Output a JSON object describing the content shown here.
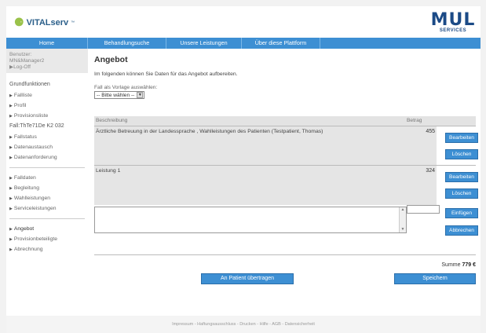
{
  "logo": {
    "name": "VITALserv",
    "trademark": "™"
  },
  "partner_logo": {
    "big": "MUL",
    "small": "SERVICES"
  },
  "nav": [
    {
      "label": "Home"
    },
    {
      "label": "Behandlungsuche"
    },
    {
      "label": "Unsere Leistungen"
    },
    {
      "label": "Über diese Plattform"
    },
    {
      "label": ""
    }
  ],
  "sidebar": {
    "user_label": "Benutzer:",
    "user_name": "MN&Manager2",
    "logoff": "Log-Off",
    "section1": "Grundfunktionen",
    "group1": [
      "Fallliste",
      "Profil",
      "Provisionsliste"
    ],
    "case_id": "Fall:ThTe71De K2 032",
    "group2": [
      "Fallstatus",
      "Datenaustausch",
      "Datenanforderung"
    ],
    "group3": [
      "Falldaten",
      "Begleitung",
      "Wahlleistungen",
      "Serviceleistungen"
    ],
    "group4": [
      "Angebot",
      "Provisionbeteiligte",
      "Abrechnung"
    ]
  },
  "main": {
    "title": "Angebot",
    "intro": "Im folgenden können Sie Daten für das Angebot aufbereiten.",
    "template_label": "Fall als Vorlage auswählen:",
    "template_value": "-- Bitte wählen --",
    "col_desc": "Beschreibung",
    "col_amount": "Betrag",
    "rows": [
      {
        "desc": "Ärztliche Betreuung in der Landessprache , Wahlleistungen des Patienten (Testpatient, Thomas)",
        "amount": "455"
      },
      {
        "desc": "Leistung 1",
        "amount": "324"
      }
    ],
    "btn_edit": "Bearbeiten",
    "btn_delete": "Löschen",
    "btn_insert": "Einfügen",
    "btn_cancel": "Abbrechen",
    "new_desc": "",
    "new_amount": "",
    "sum_label": "Summe",
    "sum_value": "779 €",
    "btn_transfer": "An Patient übertragen",
    "btn_save": "Speichern"
  },
  "footer": "Impressum  -  Haftungsausschluss  -  Drucken  -  Hilfe  -  AGB  -  Datensicherheit"
}
